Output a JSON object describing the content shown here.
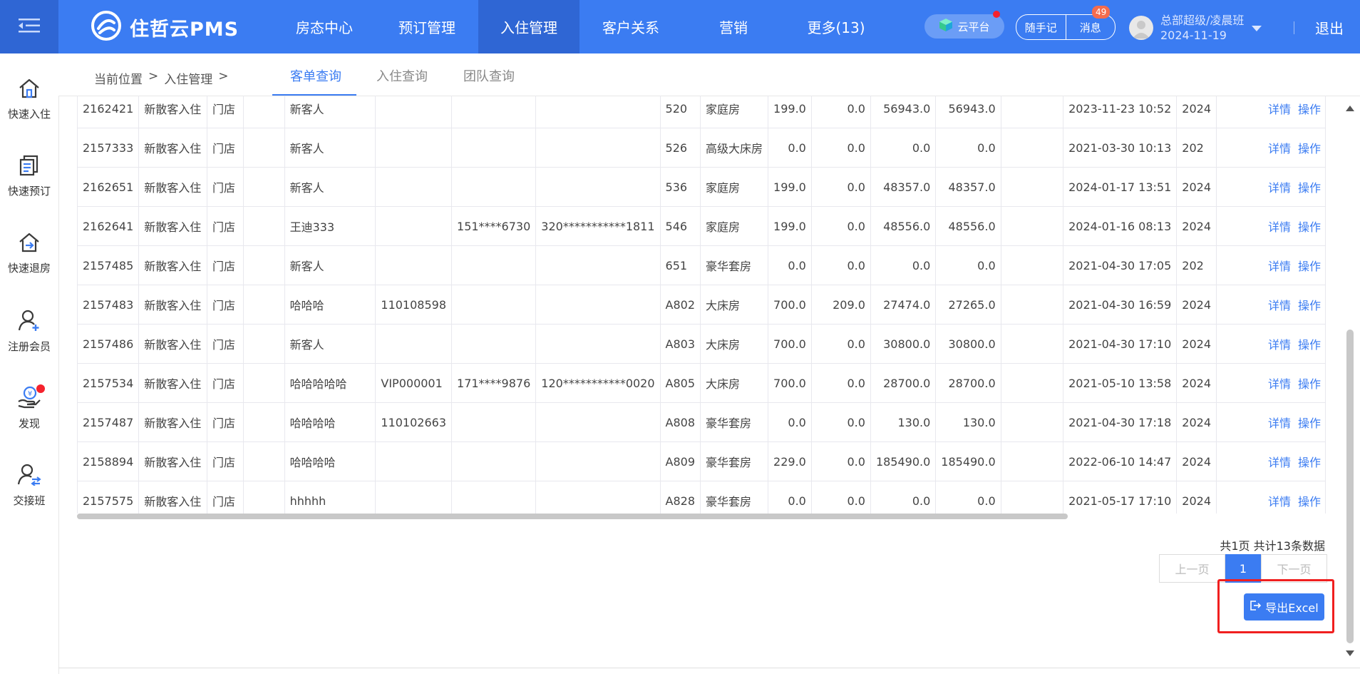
{
  "brand": {
    "name": "住哲云PMS"
  },
  "nav": {
    "items": [
      {
        "label": "房态中心"
      },
      {
        "label": "预订管理"
      },
      {
        "label": "入住管理"
      },
      {
        "label": "客户关系"
      },
      {
        "label": "营销"
      },
      {
        "label": "更多(13)"
      }
    ],
    "active_index": 2
  },
  "header": {
    "cloud_label": "云平台",
    "notes_label": "随手记",
    "messages_label": "消息",
    "messages_count": "49",
    "user_name": "总部超级/凌晨班",
    "user_date": "2024-11-19",
    "logout_label": "退出"
  },
  "sidebar": {
    "items": [
      {
        "label": "快速入住",
        "icon": "home-icon"
      },
      {
        "label": "快速预订",
        "icon": "list-icon"
      },
      {
        "label": "快速退房",
        "icon": "checkout-icon"
      },
      {
        "label": "注册会员",
        "icon": "add-user-icon"
      },
      {
        "label": "发现",
        "icon": "discover-icon"
      },
      {
        "label": "交接班",
        "icon": "shift-icon"
      }
    ]
  },
  "breadcrumb": {
    "prefix": "当前位置",
    "sep": ">",
    "section": "入住管理",
    "trail_sep": ">"
  },
  "tabs": [
    {
      "label": "客单查询"
    },
    {
      "label": "入住查询"
    },
    {
      "label": "团队查询"
    }
  ],
  "table": {
    "rows": [
      [
        "2162421",
        "新散客入住",
        "门店",
        "",
        "新客人",
        "",
        "",
        "",
        "520",
        "家庭房",
        "199.0",
        "0.0",
        "56943.0",
        "56943.0",
        "",
        "2023-11-23 10:52",
        "2024"
      ],
      [
        "2157333",
        "新散客入住",
        "门店",
        "",
        "新客人",
        "",
        "",
        "",
        "526",
        "高级大床房",
        "0.0",
        "0.0",
        "0.0",
        "0.0",
        "",
        "2021-03-30 10:13",
        "202"
      ],
      [
        "2162651",
        "新散客入住",
        "门店",
        "",
        "新客人",
        "",
        "",
        "",
        "536",
        "家庭房",
        "199.0",
        "0.0",
        "48357.0",
        "48357.0",
        "",
        "2024-01-17 13:51",
        "2024"
      ],
      [
        "2162641",
        "新散客入住",
        "门店",
        "",
        "王迪333",
        "",
        "151****6730",
        "320***********1811",
        "546",
        "家庭房",
        "199.0",
        "0.0",
        "48556.0",
        "48556.0",
        "",
        "2024-01-16 08:13",
        "2024"
      ],
      [
        "2157485",
        "新散客入住",
        "门店",
        "",
        "新客人",
        "",
        "",
        "",
        "651",
        "豪华套房",
        "0.0",
        "0.0",
        "0.0",
        "0.0",
        "",
        "2021-04-30 17:05",
        "202"
      ],
      [
        "2157483",
        "新散客入住",
        "门店",
        "",
        "哈哈哈",
        "110108598",
        "",
        "",
        "A802",
        "大床房",
        "700.0",
        "209.0",
        "27474.0",
        "27265.0",
        "",
        "2021-04-30 16:59",
        "2024"
      ],
      [
        "2157486",
        "新散客入住",
        "门店",
        "",
        "新客人",
        "",
        "",
        "",
        "A803",
        "大床房",
        "700.0",
        "0.0",
        "30800.0",
        "30800.0",
        "",
        "2021-04-30 17:10",
        "2024"
      ],
      [
        "2157534",
        "新散客入住",
        "门店",
        "",
        "哈哈哈哈哈",
        "VIP000001",
        "171****9876",
        "120***********0020",
        "A805",
        "大床房",
        "700.0",
        "0.0",
        "28700.0",
        "28700.0",
        "",
        "2021-05-10 13:58",
        "2024"
      ],
      [
        "2157487",
        "新散客入住",
        "门店",
        "",
        "哈哈哈哈",
        "110102663",
        "",
        "",
        "A808",
        "豪华套房",
        "0.0",
        "0.0",
        "130.0",
        "130.0",
        "",
        "2021-04-30 17:18",
        "2024"
      ],
      [
        "2158894",
        "新散客入住",
        "门店",
        "",
        "哈哈哈哈",
        "",
        "",
        "",
        "A809",
        "豪华套房",
        "229.0",
        "0.0",
        "185490.0",
        "185490.0",
        "",
        "2022-06-10 14:47",
        "2024"
      ],
      [
        "2157575",
        "新散客入住",
        "门店",
        "",
        "hhhhh",
        "",
        "",
        "",
        "A828",
        "豪华套房",
        "0.0",
        "0.0",
        "0.0",
        "0.0",
        "",
        "2021-05-17 17:10",
        "2024"
      ]
    ],
    "detail_label": "详情",
    "action_label": "操作"
  },
  "pagination": {
    "summary": "共1页 共计13条数据",
    "prev_label": "上一页",
    "current_page": "1",
    "next_label": "下一页"
  },
  "export": {
    "label": "导出Excel"
  },
  "colors": {
    "primary": "#3b7cf2",
    "primary_dark": "#2f66d4",
    "highlight_border": "#f01f1f",
    "badge_red": "#f5222d"
  }
}
